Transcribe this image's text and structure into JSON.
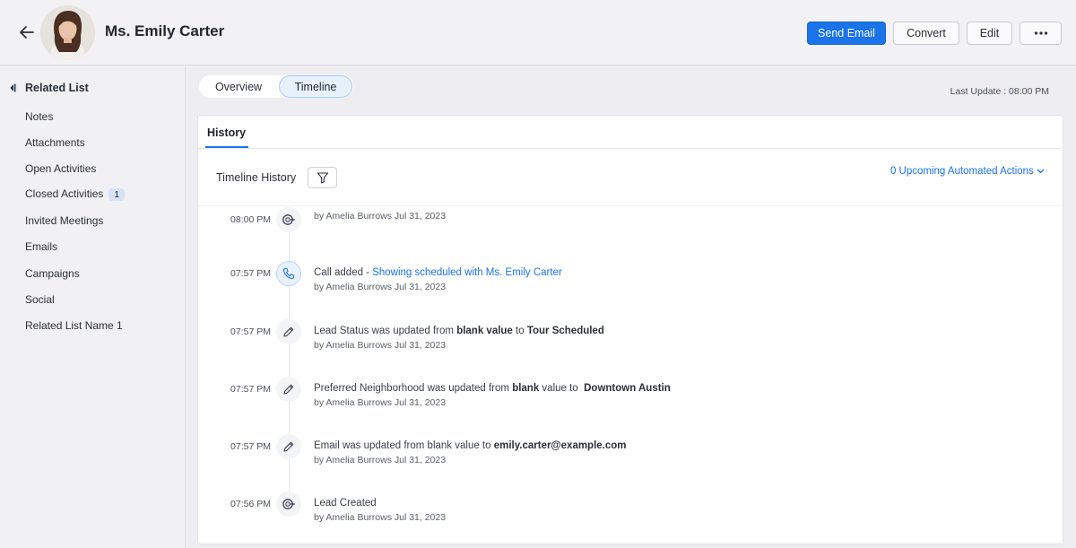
{
  "header": {
    "lead_name": "Ms. Emily Carter",
    "buttons": {
      "send_email": "Send Email",
      "convert": "Convert",
      "edit": "Edit",
      "more": "•••"
    },
    "accent": "#1a73e8"
  },
  "sidebar": {
    "title": "Related List",
    "items": [
      {
        "label": "Notes"
      },
      {
        "label": "Attachments"
      },
      {
        "label": "Open Activities"
      },
      {
        "label": "Closed Activities",
        "badge": "1"
      },
      {
        "label": "Invited Meetings"
      },
      {
        "label": "Emails"
      },
      {
        "label": "Campaigns"
      },
      {
        "label": "Social"
      },
      {
        "label": "Related List Name 1"
      }
    ]
  },
  "tabs": {
    "overview": "Overview",
    "timeline": "Timeline",
    "active": "Timeline"
  },
  "last_update": "Last Update : 08:00 PM",
  "panel": {
    "history_tab": "History",
    "timeline_history": "Timeline History",
    "upcoming": "0 Upcoming Automated Actions"
  },
  "timeline": [
    {
      "time": "08:00 PM",
      "icon": "lead-icon",
      "text": "",
      "by": "by Amelia Burrows Jul 31, 2023"
    },
    {
      "time": "07:57 PM",
      "icon": "phone-icon",
      "text_pre": "Call added - ",
      "text_link": "Showing scheduled with Ms. Emily Carter",
      "by": "by Amelia Burrows Jul 31, 2023"
    },
    {
      "time": "07:57 PM",
      "icon": "pencil-icon",
      "text_pre": "Lead Status was updated from ",
      "text_b1": "blank value",
      "text_mid": " to ",
      "text_b2": "Tour Scheduled",
      "by": "by Amelia Burrows Jul 31, 2023"
    },
    {
      "time": "07:57 PM",
      "icon": "pencil-icon",
      "text_pre": "Preferred Neighborhood was updated from ",
      "text_b1": "blank",
      "text_mid": " value to  ",
      "text_b2": "Downtown Austin",
      "by": "by Amelia Burrows Jul 31, 2023"
    },
    {
      "time": "07:57 PM",
      "icon": "pencil-icon",
      "text_pre": "Email was updated from blank value to ",
      "text_b1": "emily.carter@example.com",
      "by": "by Amelia Burrows Jul 31, 2023"
    },
    {
      "time": "07:56 PM",
      "icon": "lead-icon",
      "text_pre": "Lead Created",
      "by": "by Amelia Burrows Jul 31, 2023"
    }
  ]
}
